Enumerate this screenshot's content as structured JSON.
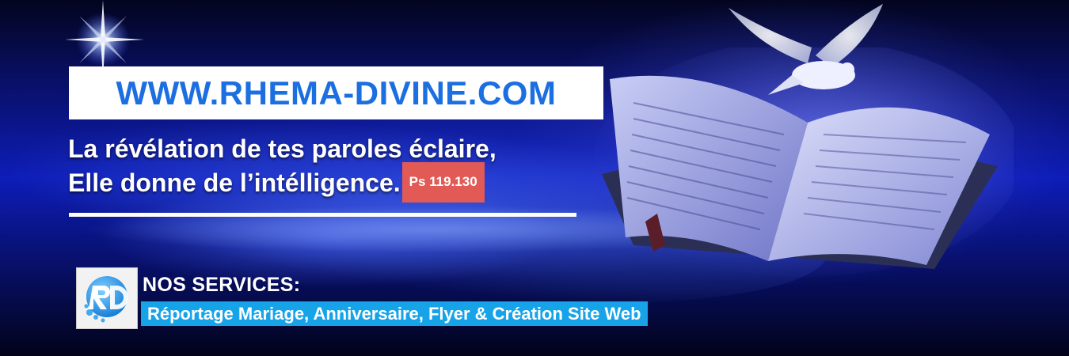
{
  "site": {
    "url": "WWW.RHEMA-DIVINE.COM"
  },
  "verse": {
    "line1": "La révélation de tes paroles éclaire,",
    "line2": "Elle donne de l’intélligence.",
    "reference": "Ps 119.130"
  },
  "services": {
    "title": "NOS SERVICES:",
    "list": "Réportage Mariage, Anniversaire, Flyer  & Création Site Web"
  },
  "logo": {
    "icon": "rd-logo-icon"
  },
  "colors": {
    "url_text": "#1c6fe0",
    "reference_badge": "#e15a55",
    "services_bar": "#17a3e8"
  }
}
